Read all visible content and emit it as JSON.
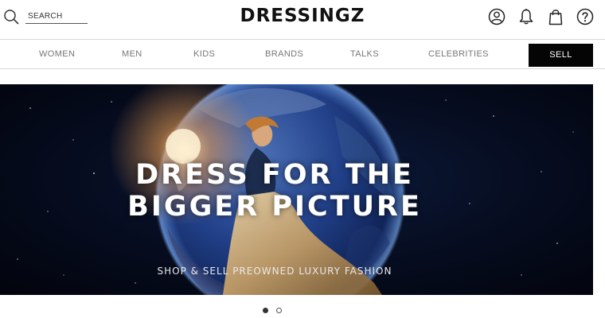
{
  "header": {
    "search_placeholder": "SEARCH",
    "logo": "DRESSINGZ",
    "icons": [
      "account-icon",
      "bell-icon",
      "bag-icon",
      "help-icon"
    ]
  },
  "nav": {
    "items": [
      "WOMEN",
      "MEN",
      "KIDS",
      "BRANDS",
      "TALKS",
      "CELEBRITIES"
    ],
    "sell_label": "SELL"
  },
  "hero": {
    "headline_line1": "DRESS FOR THE",
    "headline_line2": "BIGGER PICTURE",
    "subtitle": "SHOP & SELL PREOWNED LUXURY FASHION"
  },
  "carousel": {
    "slide_count": 2,
    "active_index": 0
  },
  "colors": {
    "sell_bg": "#050505",
    "nav_text": "#777777",
    "hero_bg": "#060c1f"
  }
}
